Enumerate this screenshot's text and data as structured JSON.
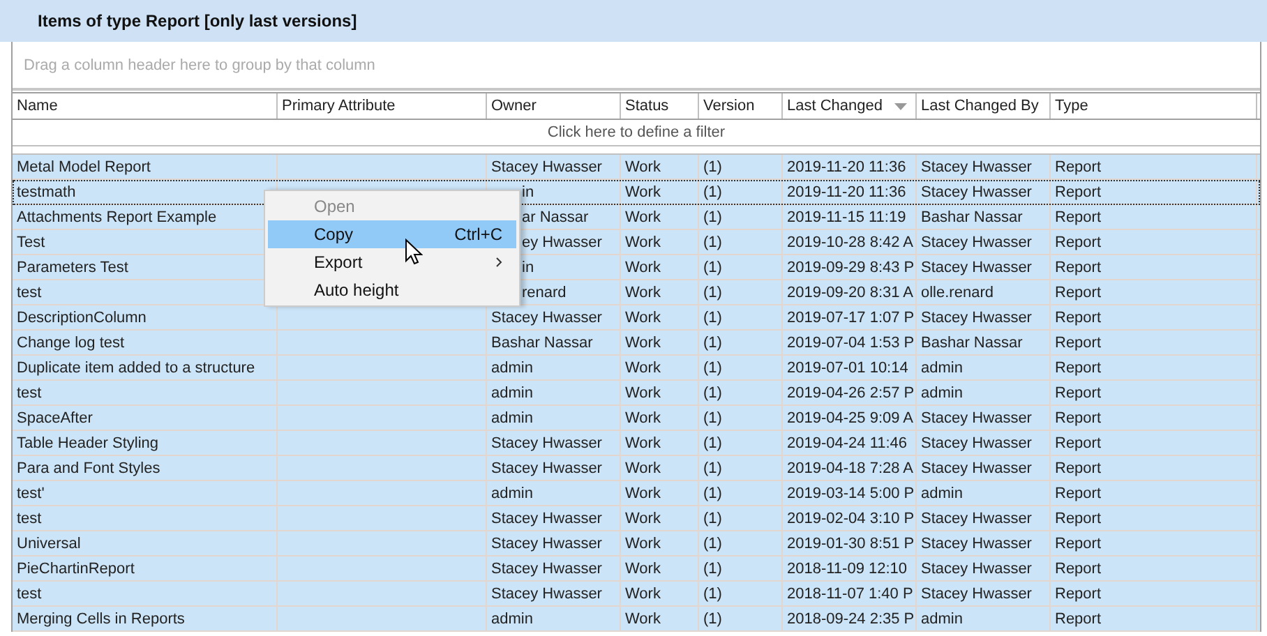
{
  "panel": {
    "title": "Items of type Report [only last versions]"
  },
  "group_panel": {
    "hint": "Drag a column header here to group by that column"
  },
  "table": {
    "columns": [
      {
        "label": "Name",
        "sorted": false
      },
      {
        "label": "Primary Attribute",
        "sorted": false
      },
      {
        "label": "Owner",
        "sorted": false
      },
      {
        "label": "Status",
        "sorted": false
      },
      {
        "label": "Version",
        "sorted": false
      },
      {
        "label": "Last Changed",
        "sorted": true
      },
      {
        "label": "Last Changed By",
        "sorted": false
      },
      {
        "label": "Type",
        "sorted": false
      }
    ],
    "filter_row": "Click here to define a filter",
    "rows": [
      {
        "cells": [
          "Metal Model Report",
          "",
          "Stacey Hwasser",
          "Work",
          "(1)",
          "2019-11-20 11:36",
          "Stacey Hwasser",
          "Report"
        ],
        "selected": true,
        "focused": false,
        "owner_covered": false
      },
      {
        "cells": [
          "testmath",
          "",
          "in",
          "Work",
          "(1)",
          "2019-11-20 11:36",
          "Stacey Hwasser",
          "Report"
        ],
        "selected": true,
        "focused": true,
        "owner_covered": true
      },
      {
        "cells": [
          "Attachments Report Example",
          "",
          "ar Nassar",
          "Work",
          "(1)",
          "2019-11-15 11:19",
          "Bashar Nassar",
          "Report"
        ],
        "selected": true,
        "focused": false,
        "owner_covered": true
      },
      {
        "cells": [
          "Test",
          "",
          "ey Hwasser",
          "Work",
          "(1)",
          "2019-10-28 8:42 A",
          "Stacey Hwasser",
          "Report"
        ],
        "selected": true,
        "focused": false,
        "owner_covered": true
      },
      {
        "cells": [
          "Parameters Test",
          "",
          "in",
          "Work",
          "(1)",
          "2019-09-29 8:43 P",
          "Stacey Hwasser",
          "Report"
        ],
        "selected": true,
        "focused": false,
        "owner_covered": true
      },
      {
        "cells": [
          "test",
          "",
          "renard",
          "Work",
          "(1)",
          "2019-09-20 8:31 A",
          "olle.renard",
          "Report"
        ],
        "selected": true,
        "focused": false,
        "owner_covered": true
      },
      {
        "cells": [
          "DescriptionColumn",
          "",
          "Stacey Hwasser",
          "Work",
          "(1)",
          "2019-07-17 1:07 P",
          "Stacey Hwasser",
          "Report"
        ],
        "selected": true,
        "focused": false,
        "owner_covered": false
      },
      {
        "cells": [
          "Change log test",
          "",
          "Bashar Nassar",
          "Work",
          "(1)",
          "2019-07-04 1:53 P",
          "Bashar Nassar",
          "Report"
        ],
        "selected": true,
        "focused": false,
        "owner_covered": false
      },
      {
        "cells": [
          "Duplicate item added to a structure",
          "",
          "admin",
          "Work",
          "(1)",
          "2019-07-01 10:14",
          "admin",
          "Report"
        ],
        "selected": true,
        "focused": false,
        "owner_covered": false
      },
      {
        "cells": [
          "test",
          "",
          "admin",
          "Work",
          "(1)",
          "2019-04-26 2:57 P",
          "admin",
          "Report"
        ],
        "selected": true,
        "focused": false,
        "owner_covered": false
      },
      {
        "cells": [
          "SpaceAfter",
          "",
          "admin",
          "Work",
          "(1)",
          "2019-04-25 9:09 A",
          "Stacey Hwasser",
          "Report"
        ],
        "selected": true,
        "focused": false,
        "owner_covered": false
      },
      {
        "cells": [
          "Table Header Styling",
          "",
          "Stacey Hwasser",
          "Work",
          "(1)",
          "2019-04-24 11:46",
          "Stacey Hwasser",
          "Report"
        ],
        "selected": true,
        "focused": false,
        "owner_covered": false
      },
      {
        "cells": [
          "Para and Font Styles",
          "",
          "Stacey Hwasser",
          "Work",
          "(1)",
          "2019-04-18 7:28 A",
          "Stacey Hwasser",
          "Report"
        ],
        "selected": true,
        "focused": false,
        "owner_covered": false
      },
      {
        "cells": [
          "test'",
          "",
          "admin",
          "Work",
          "(1)",
          "2019-03-14 5:00 P",
          "admin",
          "Report"
        ],
        "selected": true,
        "focused": false,
        "owner_covered": false
      },
      {
        "cells": [
          "test",
          "",
          "Stacey Hwasser",
          "Work",
          "(1)",
          "2019-02-04 3:10 P",
          "Stacey Hwasser",
          "Report"
        ],
        "selected": true,
        "focused": false,
        "owner_covered": false
      },
      {
        "cells": [
          "Universal",
          "",
          "Stacey Hwasser",
          "Work",
          "(1)",
          "2019-01-30 8:51 P",
          "Stacey Hwasser",
          "Report"
        ],
        "selected": true,
        "focused": false,
        "owner_covered": false
      },
      {
        "cells": [
          "PieChartinReport",
          "",
          "Stacey Hwasser",
          "Work",
          "(1)",
          "2018-11-09 12:10",
          "Stacey Hwasser",
          "Report"
        ],
        "selected": true,
        "focused": false,
        "owner_covered": false
      },
      {
        "cells": [
          "test",
          "",
          "Stacey Hwasser",
          "Work",
          "(1)",
          "2018-11-07 1:40 P",
          "Stacey Hwasser",
          "Report"
        ],
        "selected": true,
        "focused": false,
        "owner_covered": false
      },
      {
        "cells": [
          "Merging Cells in Reports",
          "",
          "admin",
          "Work",
          "(1)",
          "2018-09-24 2:35 P",
          "admin",
          "Report"
        ],
        "selected": true,
        "focused": false,
        "owner_covered": false
      }
    ]
  },
  "context_menu": {
    "items": [
      {
        "label": "Open",
        "submenu": false,
        "disabled": true,
        "selected": false
      },
      {
        "label": "Copy",
        "shortcut": "Ctrl+C",
        "submenu": false,
        "disabled": false,
        "selected": true
      },
      {
        "label": "Export",
        "submenu": true,
        "disabled": false,
        "selected": false
      },
      {
        "label": "Auto height",
        "submenu": false,
        "disabled": false,
        "selected": false
      }
    ]
  }
}
